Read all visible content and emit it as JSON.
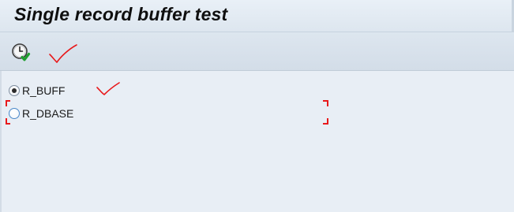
{
  "window": {
    "title": "Single record buffer test"
  },
  "toolbar": {
    "execute_icon": "clock-execute-icon"
  },
  "selection": {
    "options": [
      {
        "label": "R_BUFF",
        "selected": true
      },
      {
        "label": "R_DBASE",
        "selected": false
      }
    ]
  },
  "colors": {
    "annotation": "#e8191b",
    "background": "#e8eef5",
    "radio_focus": "#4a88c9"
  }
}
